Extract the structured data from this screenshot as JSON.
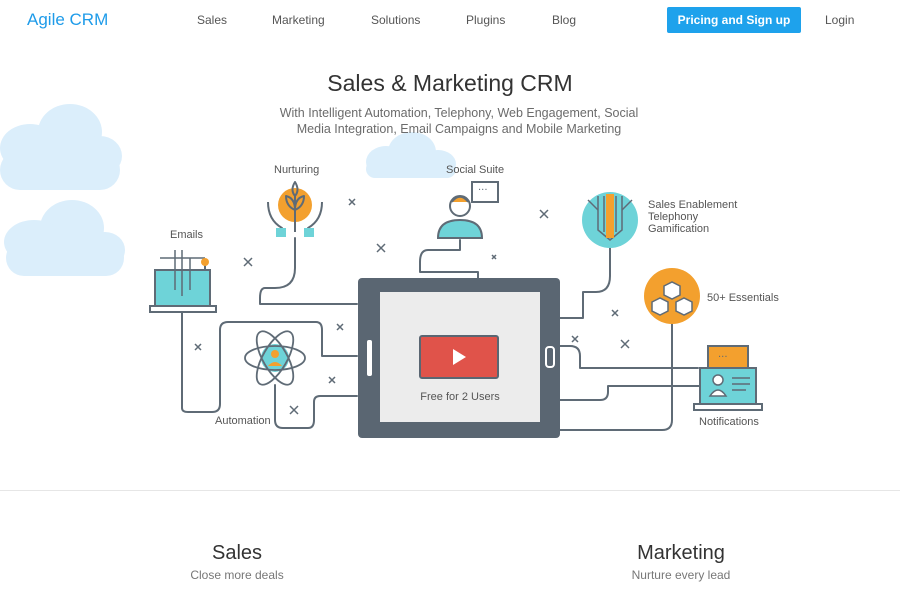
{
  "nav": {
    "logo": "Agile CRM",
    "links": [
      "Sales",
      "Marketing",
      "Solutions",
      "Plugins",
      "Blog"
    ],
    "cta": "Pricing and Sign up",
    "login": "Login"
  },
  "hero": {
    "title": "Sales & Marketing CRM",
    "subtitle": "With Intelligent Automation, Telephony, Web Engagement, Social Media Integration, Email Campaigns and Mobile Marketing"
  },
  "illustration": {
    "labels": {
      "nurturing": "Nurturing",
      "social_suite": "Social Suite",
      "emails": "Emails",
      "sales_enablement": "Sales Enablement",
      "telephony": "Telephony",
      "gamification": "Gamification",
      "essentials": "50+ Essentials",
      "automation": "Automation",
      "notifications": "Notifications"
    },
    "video_caption": "Free for 2 Users",
    "colors": {
      "line": "#5f6b76",
      "teal": "#6ed3d8",
      "orange": "#f3a02e",
      "red": "#e0534a",
      "cloud": "#dbeefb"
    }
  },
  "features": {
    "sales": {
      "title": "Sales",
      "subtitle": "Close more deals"
    },
    "marketing": {
      "title": "Marketing",
      "subtitle": "Nurture every lead"
    }
  }
}
